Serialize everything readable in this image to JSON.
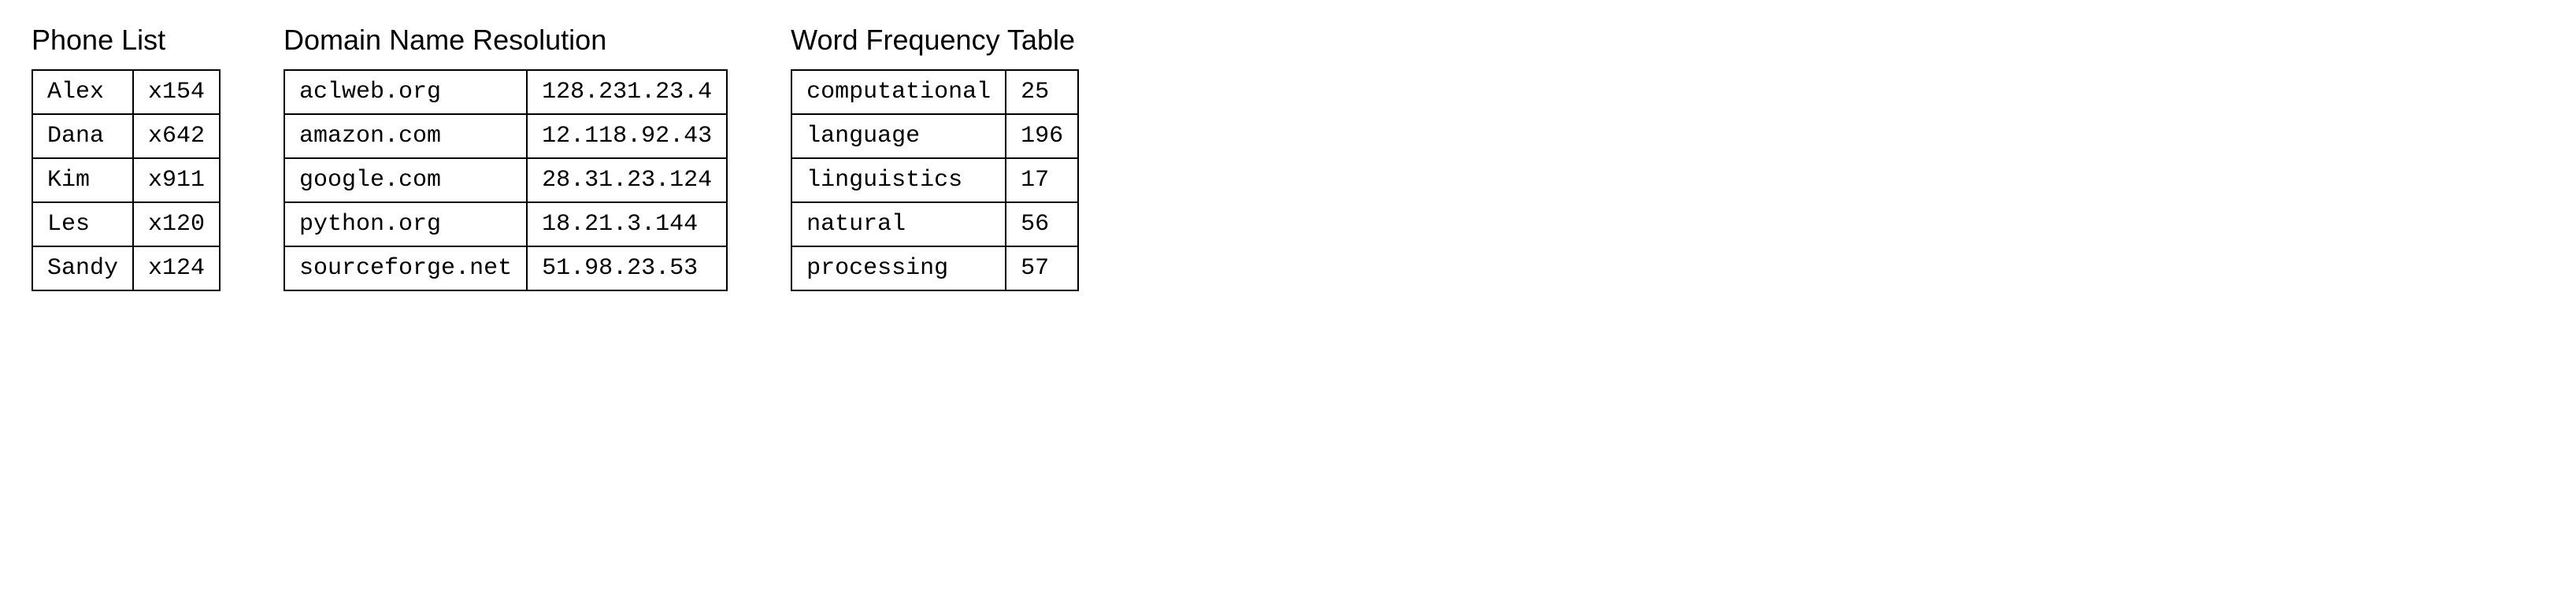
{
  "phone_list": {
    "title": "Phone List",
    "rows": [
      {
        "name": "Alex",
        "ext": "x154"
      },
      {
        "name": "Dana",
        "ext": "x642"
      },
      {
        "name": "Kim",
        "ext": "x911"
      },
      {
        "name": "Les",
        "ext": "x120"
      },
      {
        "name": "Sandy",
        "ext": "x124"
      }
    ]
  },
  "domain_list": {
    "title": "Domain Name Resolution",
    "rows": [
      {
        "domain": "aclweb.org",
        "ip": "128.231.23.4"
      },
      {
        "domain": "amazon.com",
        "ip": "12.118.92.43"
      },
      {
        "domain": "google.com",
        "ip": "28.31.23.124"
      },
      {
        "domain": "python.org",
        "ip": "18.21.3.144"
      },
      {
        "domain": "sourceforge.net",
        "ip": "51.98.23.53"
      }
    ]
  },
  "word_freq": {
    "title": "Word Frequency Table",
    "rows": [
      {
        "word": "computational",
        "freq": "25"
      },
      {
        "word": "language",
        "freq": "196"
      },
      {
        "word": "linguistics",
        "freq": "17"
      },
      {
        "word": "natural",
        "freq": "56"
      },
      {
        "word": "processing",
        "freq": "57"
      }
    ]
  }
}
